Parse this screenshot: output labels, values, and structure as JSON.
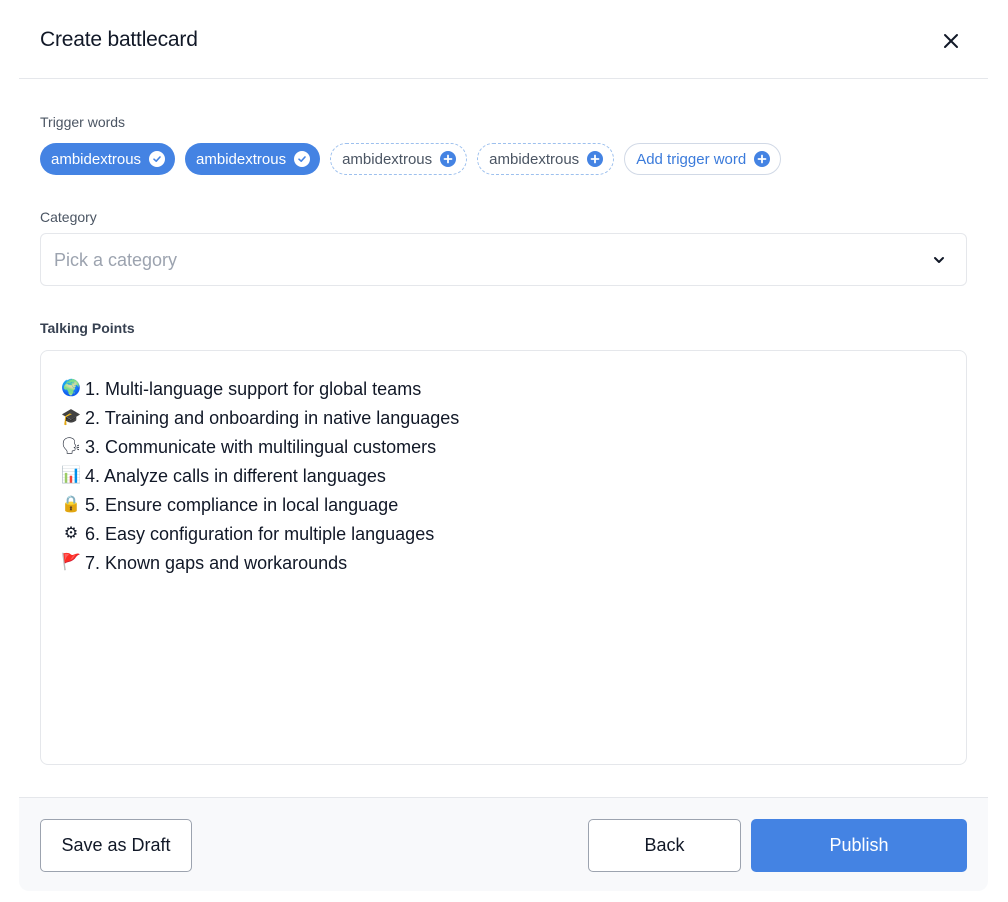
{
  "dialog": {
    "title": "Create battlecard",
    "close_icon": "close-icon"
  },
  "trigger_words": {
    "label": "Trigger words",
    "chips": [
      {
        "text": "ambidextrous",
        "state": "selected",
        "icon": "check-circle-icon"
      },
      {
        "text": "ambidextrous",
        "state": "selected",
        "icon": "check-circle-icon"
      },
      {
        "text": "ambidextrous",
        "state": "suggested",
        "icon": "plus-circle-icon"
      },
      {
        "text": "ambidextrous",
        "state": "suggested",
        "icon": "plus-circle-icon"
      }
    ],
    "add_label": "Add trigger word"
  },
  "category": {
    "label": "Category",
    "placeholder": "Pick a category",
    "value": ""
  },
  "talking_points": {
    "label": "Talking Points",
    "lines": [
      {
        "emoji": "🌍",
        "icon": "globe-icon",
        "text": "1. Multi-language support for global teams"
      },
      {
        "emoji": "🎓",
        "icon": "graduation-cap-icon",
        "text": "2. Training and onboarding in native languages"
      },
      {
        "emoji": "🗣",
        "icon": "speaking-head-icon",
        "text": "3. Communicate with multilingual customers"
      },
      {
        "emoji": "📊",
        "icon": "bar-chart-icon",
        "text": "4. Analyze calls in different languages"
      },
      {
        "emoji": "🔒",
        "icon": "lock-icon",
        "text": "5. Ensure compliance in local language"
      },
      {
        "emoji": "⚙",
        "icon": "gear-icon",
        "text": "6. Easy configuration for multiple languages"
      },
      {
        "emoji": "🚩",
        "icon": "red-flag-icon",
        "text": "7. Known gaps and workarounds"
      }
    ]
  },
  "footer": {
    "save_draft_label": "Save as Draft",
    "back_label": "Back",
    "publish_label": "Publish"
  },
  "colors": {
    "accent": "#4483e3",
    "border": "#e5e7eb",
    "footer_bg": "#f8f9fb"
  }
}
